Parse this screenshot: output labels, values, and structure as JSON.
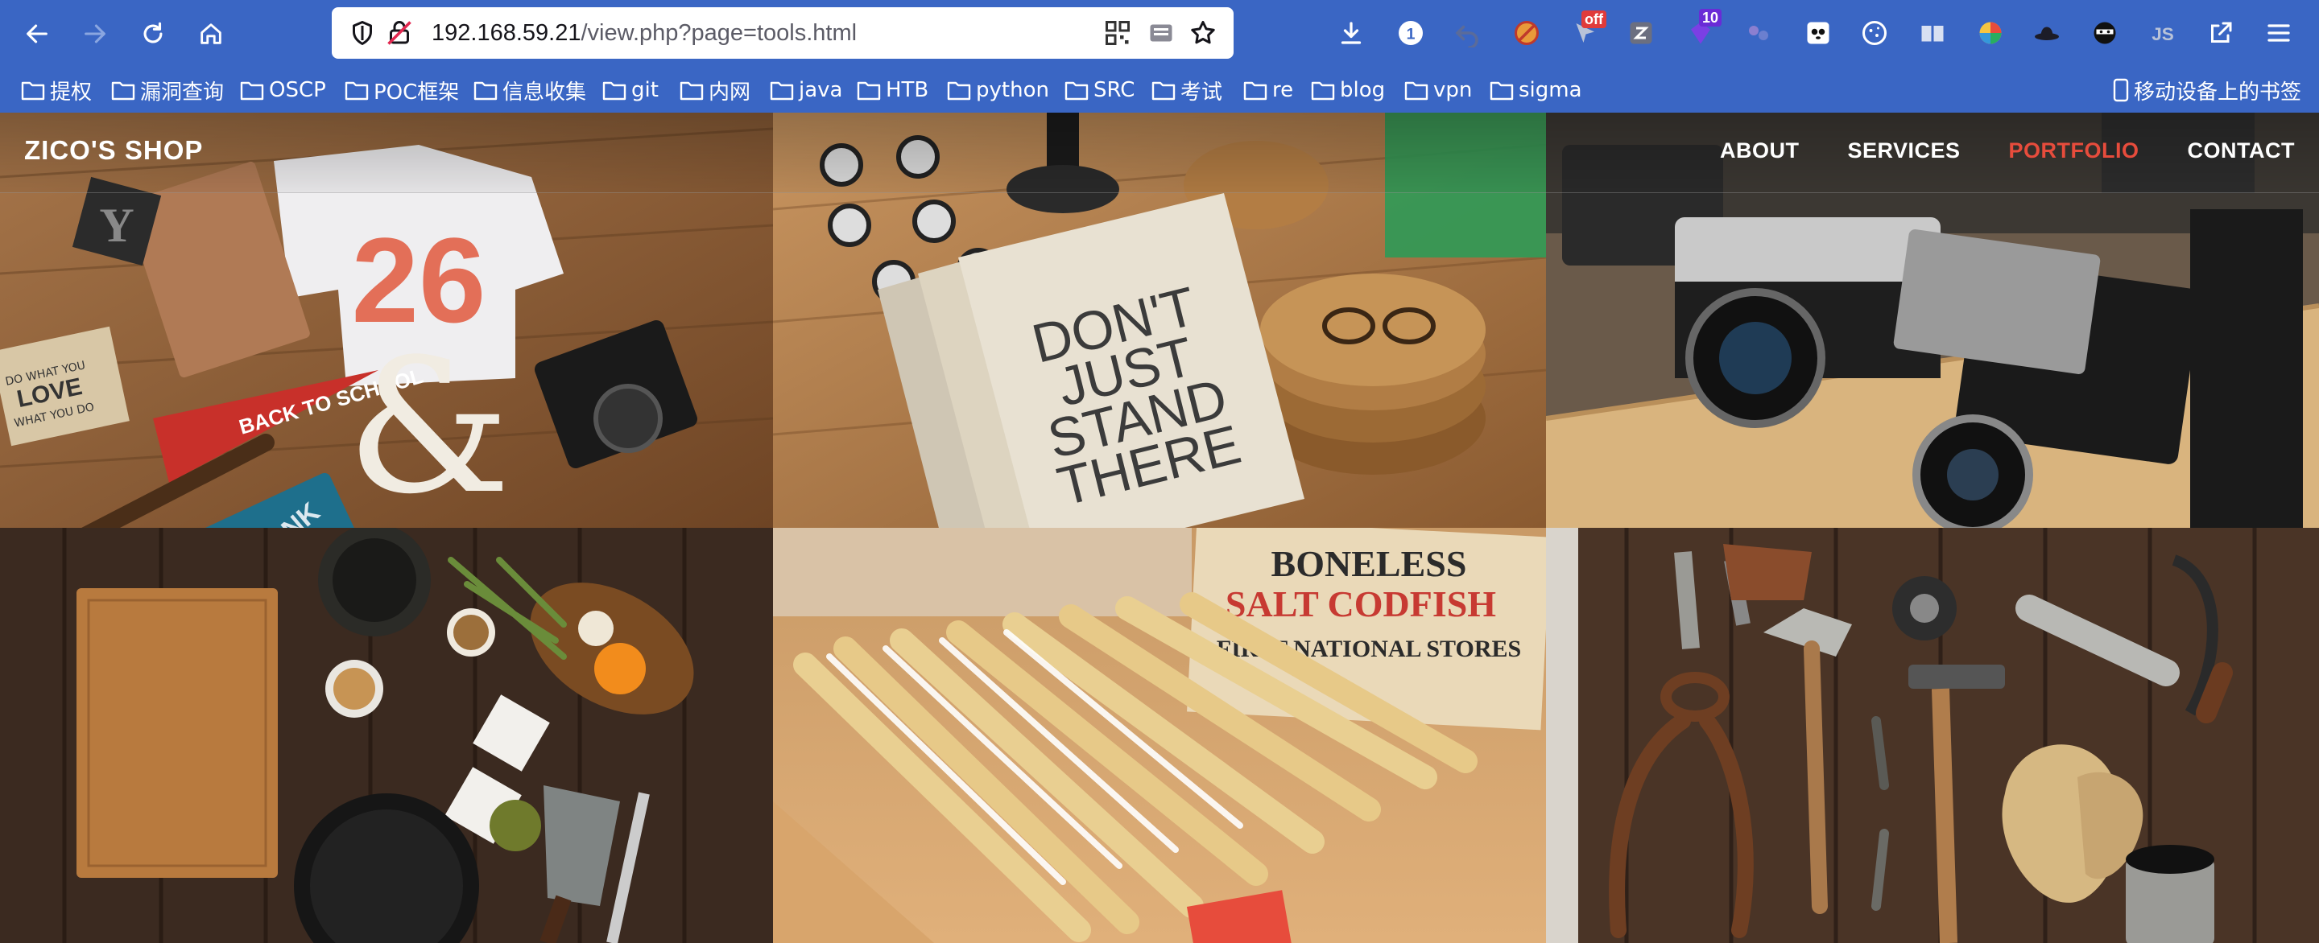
{
  "browser": {
    "url_host": "192.168.59.21",
    "url_path": "/view.php?page=tools.html",
    "extensions": [
      {
        "name": "download-icon"
      },
      {
        "name": "extension-badge-1",
        "badge": "1"
      },
      {
        "name": "undo-extension-icon"
      },
      {
        "name": "blocked-extension-icon"
      },
      {
        "name": "proxy-extension-icon",
        "badge": "off",
        "badge_color": "#e03b3b"
      },
      {
        "name": "z-extension-icon"
      },
      {
        "name": "gem-extension-icon",
        "badge": "10",
        "badge_color": "#6a2bd6"
      },
      {
        "name": "dots-extension-icon"
      },
      {
        "name": "panda-extension-icon"
      },
      {
        "name": "cookie-extension-icon"
      },
      {
        "name": "book-extension-icon"
      },
      {
        "name": "color-picker-extension-icon"
      },
      {
        "name": "hat-extension-icon"
      },
      {
        "name": "ninja-extension-icon"
      },
      {
        "name": "js-extension-icon"
      },
      {
        "name": "share-extension-icon"
      },
      {
        "name": "menu-icon"
      }
    ]
  },
  "bookmarks": {
    "items": [
      "提权",
      "漏洞查询",
      "OSCP",
      "POC框架",
      "信息收集",
      "git",
      "内网",
      "java",
      "HTB",
      "python",
      "SRC",
      "考试",
      "re",
      "blog",
      "vpn",
      "sigma"
    ],
    "mobile": "移动设备上的书签"
  },
  "site": {
    "logo": "ZICO'S SHOP",
    "nav": [
      "ABOUT",
      "SERVICES",
      "PORTFOLIO",
      "CONTACT"
    ],
    "active_nav": "PORTFOLIO",
    "accent_color": "#e74c3c"
  },
  "gallery": {
    "notebook_text": [
      "DON'T",
      "JUST",
      "STAND",
      "THERE"
    ],
    "pennant_text": "BACK TO SCHOOL",
    "box_text": [
      "BONELESS",
      "SALT CODFISH",
      "FIRST NATIONAL STORES"
    ],
    "tshirt_number": "26",
    "sign_text": [
      "DO WHAT YOU",
      "LOVE",
      "WHAT YOU DO"
    ],
    "wood_block_letter": "Y",
    "badge_text": "UGMONK"
  },
  "colors": {
    "chrome_bg": "#3a66c4",
    "url_bg": "#ffffff"
  }
}
